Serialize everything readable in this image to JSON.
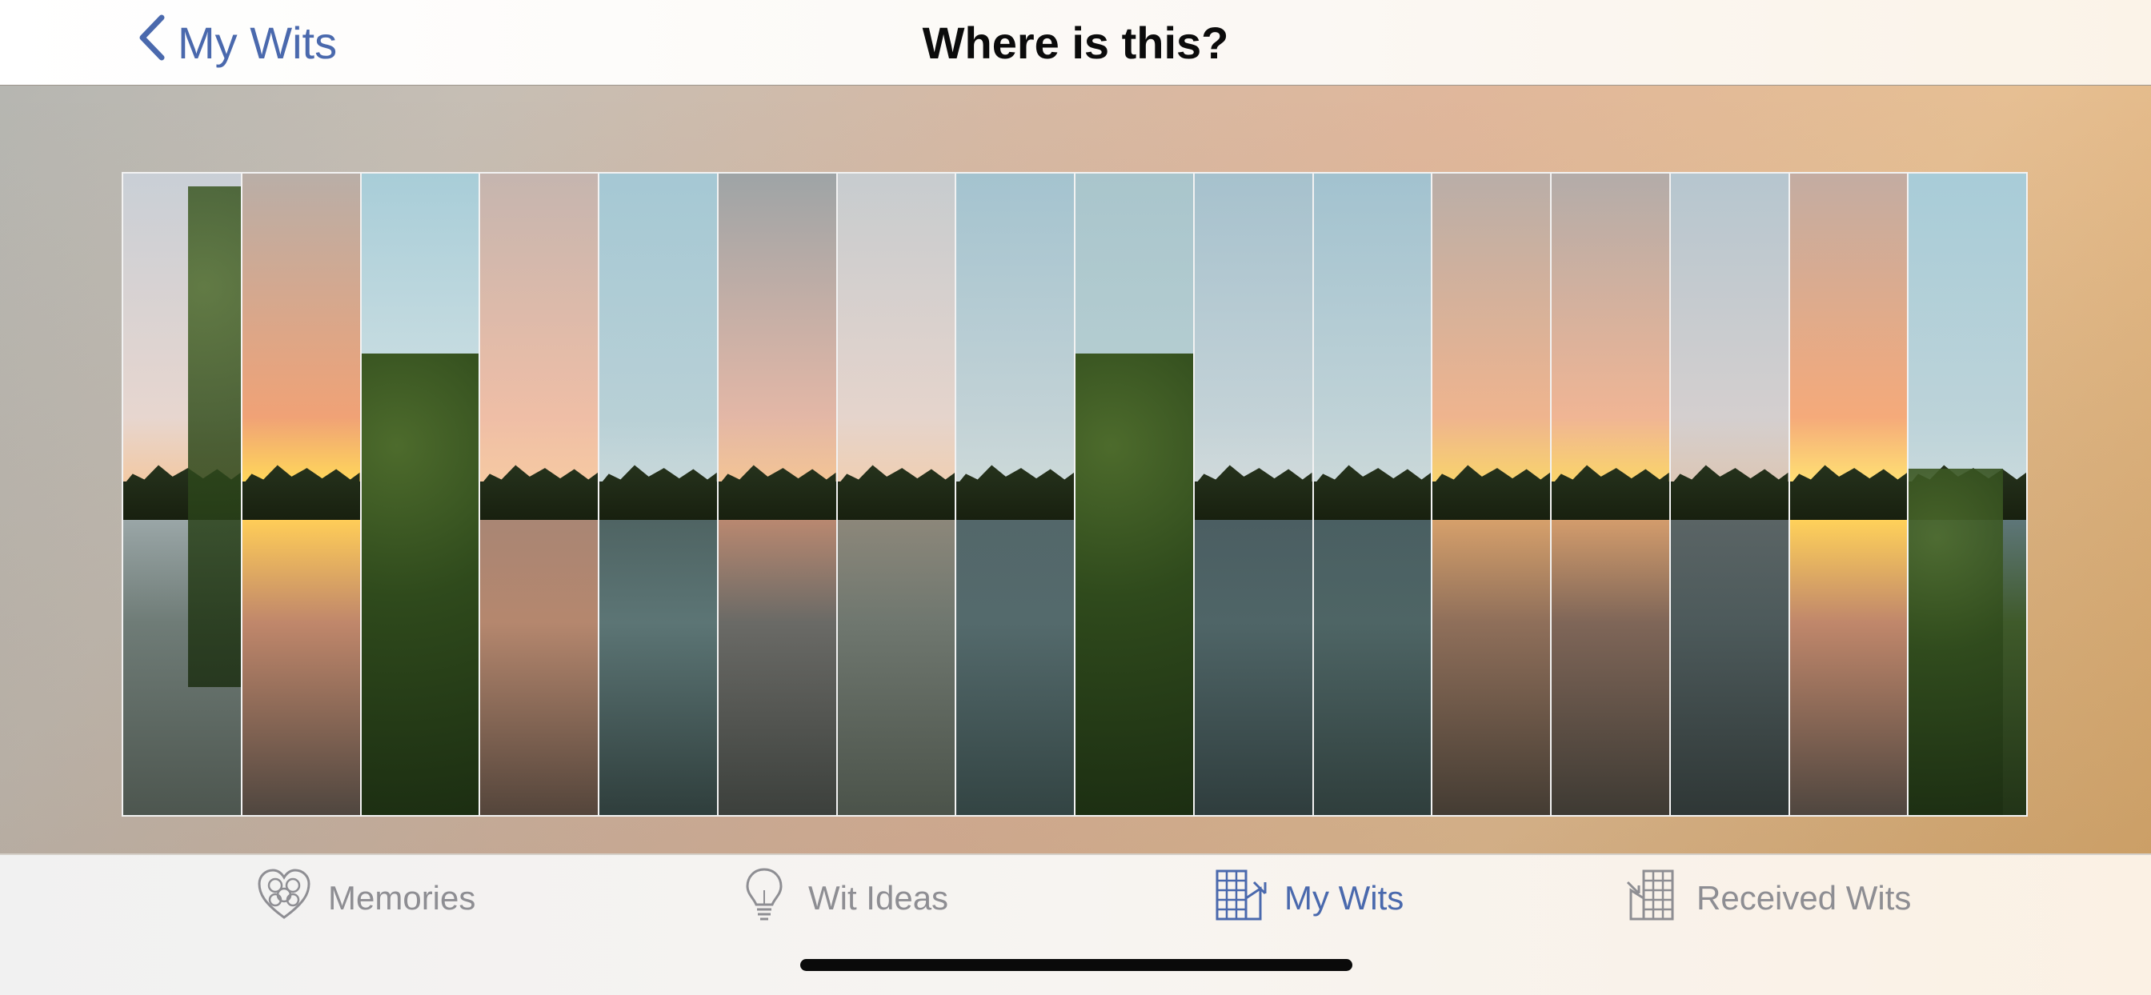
{
  "navbar": {
    "back_label": "My Wits",
    "title": "Where is this?"
  },
  "panorama": {
    "strip_count": 16,
    "strips": [
      {
        "sky_top": "#c9cfd6",
        "sky_mid": "#e7d6cf",
        "horizon": "#f2c9a4",
        "water_top": "#9aa6a7",
        "water_mid": "#6f7c77",
        "water_bottom": "#4d564f",
        "foliage": "right"
      },
      {
        "sky_top": "#b9aea7",
        "sky_mid": "#f0a276",
        "horizon": "#ffd75a",
        "water_top": "#ffcd58",
        "water_mid": "#c0876b",
        "water_bottom": "#4f463f",
        "foliage": "none"
      },
      {
        "sky_top": "#a8cdd8",
        "sky_mid": "#cfe0e3",
        "horizon": "#d8e3e2",
        "water_top": "#36522a",
        "water_mid": "#2b4a20",
        "water_bottom": "#1e3416",
        "foliage": "full"
      },
      {
        "sky_top": "#c5b5af",
        "sky_mid": "#efbea6",
        "horizon": "#f6c9a2",
        "water_top": "#a98674",
        "water_mid": "#b5876e",
        "water_bottom": "#54453b",
        "foliage": "none"
      },
      {
        "sky_top": "#a5c8d4",
        "sky_mid": "#b8d0d6",
        "horizon": "#c8d8da",
        "water_top": "#4f6463",
        "water_mid": "#5c7575",
        "water_bottom": "#2f3e3c",
        "foliage": "none"
      },
      {
        "sky_top": "#9ea4a6",
        "sky_mid": "#e3b7a6",
        "horizon": "#f3c495",
        "water_top": "#b98870",
        "water_mid": "#6a6a66",
        "water_bottom": "#3c403c",
        "foliage": "none"
      },
      {
        "sky_top": "#c7cccf",
        "sky_mid": "#e5d4cc",
        "horizon": "#efcfb3",
        "water_top": "#8c877a",
        "water_mid": "#6f776f",
        "water_bottom": "#4b534a",
        "foliage": "none"
      },
      {
        "sky_top": "#a4c3cf",
        "sky_mid": "#c2d2d6",
        "horizon": "#ccd9d9",
        "water_top": "#53676a",
        "water_mid": "#546a6c",
        "water_bottom": "#334443",
        "foliage": "none"
      },
      {
        "sky_top": "#a9c5cc",
        "sky_mid": "#b7cfd2",
        "horizon": "#c2d2cf",
        "water_top": "#3c5a25",
        "water_mid": "#476730",
        "water_bottom": "#2f3e28",
        "foliage": "full"
      },
      {
        "sky_top": "#a6c1cd",
        "sky_mid": "#c3d2d7",
        "horizon": "#d0dadb",
        "water_top": "#4b5e62",
        "water_mid": "#4f6567",
        "water_bottom": "#2f3d3d",
        "foliage": "none"
      },
      {
        "sky_top": "#a2c2cf",
        "sky_mid": "#bfd2d7",
        "horizon": "#cad8d9",
        "water_top": "#4a5f62",
        "water_mid": "#4e6565",
        "water_bottom": "#2f3e3c",
        "foliage": "none"
      },
      {
        "sky_top": "#b9aea8",
        "sky_mid": "#efb48e",
        "horizon": "#f8d36d",
        "water_top": "#d6a06b",
        "water_mid": "#8f6f5a",
        "water_bottom": "#443c33",
        "foliage": "none"
      },
      {
        "sky_top": "#b3aca9",
        "sky_mid": "#f0b594",
        "horizon": "#fad46a",
        "water_top": "#d39c6c",
        "water_mid": "#7f6658",
        "water_bottom": "#3e3a33",
        "foliage": "none"
      },
      {
        "sky_top": "#b6c6cf",
        "sky_mid": "#d4cfcf",
        "horizon": "#dcc7b6",
        "water_top": "#5a6465",
        "water_mid": "#4d5a5b",
        "water_bottom": "#2f3736",
        "foliage": "none"
      },
      {
        "sky_top": "#c3aca2",
        "sky_mid": "#f5aa7a",
        "horizon": "#ffe073",
        "water_top": "#ffd15a",
        "water_mid": "#c0876b",
        "water_bottom": "#4f463f",
        "foliage": "none"
      },
      {
        "sky_top": "#a8ccd8",
        "sky_mid": "#bcd3d9",
        "horizon": "#c8d9dc",
        "water_top": "#5e7679",
        "water_mid": "#3f5a2a",
        "water_bottom": "#223417",
        "foliage": "right-bottom"
      }
    ]
  },
  "tabbar": {
    "tabs": [
      {
        "label": "Memories",
        "icon": "heart-icon",
        "active": false
      },
      {
        "label": "Wit Ideas",
        "icon": "lightbulb-icon",
        "active": false
      },
      {
        "label": "My Wits",
        "icon": "building-icon",
        "active": true
      },
      {
        "label": "Received Wits",
        "icon": "received-building-icon",
        "active": false
      }
    ],
    "active_color": "#4a69ad",
    "inactive_color": "#8e8e93"
  }
}
